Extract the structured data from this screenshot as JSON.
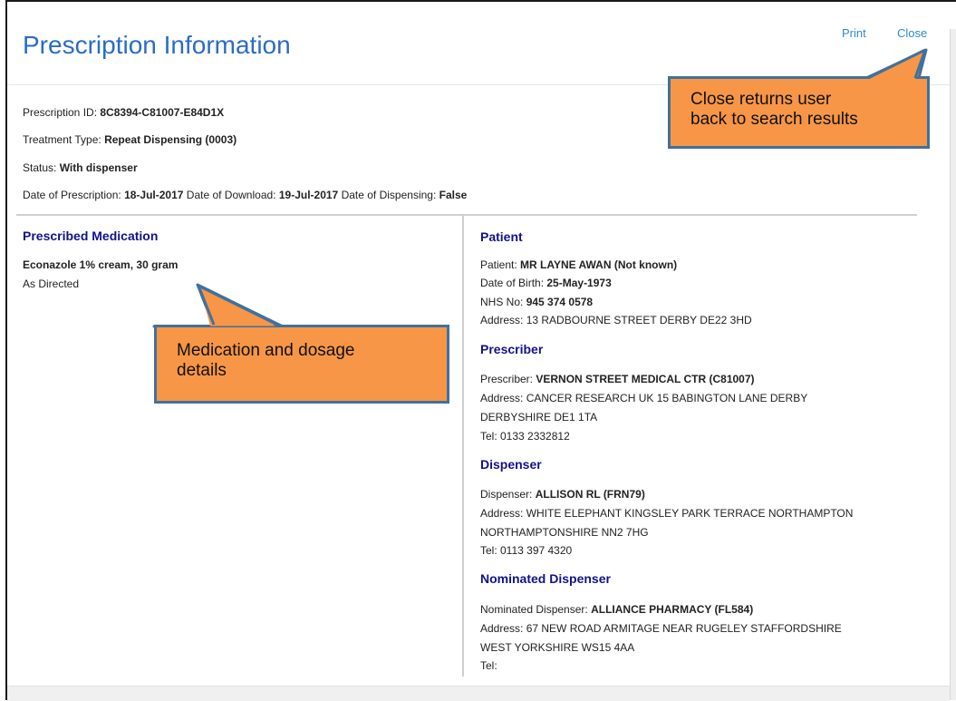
{
  "header": {
    "title": "Prescription Information",
    "print_label": "Print",
    "close_label": "Close"
  },
  "meta": {
    "prescription_id_label": "Prescription ID:",
    "prescription_id": "8C8394-C81007-E84D1X",
    "treatment_type_label": "Treatment Type:",
    "treatment_type": "Repeat Dispensing (0003)",
    "status_label": "Status:",
    "status": "With dispenser",
    "date_of_prescription_label": "Date of Prescription:",
    "date_of_prescription": "18-Jul-2017",
    "date_of_download_label": "Date of Download:",
    "date_of_download": "19-Jul-2017",
    "date_of_dispensing_label": "Date of Dispensing:",
    "date_of_dispensing": "False"
  },
  "medication": {
    "heading": "Prescribed Medication",
    "item": "Econazole 1% cream, 30 gram",
    "dosage": "As Directed"
  },
  "patient": {
    "heading": "Patient",
    "name_label": "Patient:",
    "name": "MR LAYNE AWAN (Not known)",
    "dob_label": "Date of Birth:",
    "dob": "25-May-1973",
    "nhs_label": "NHS No:",
    "nhs": "945 374 0578",
    "address": "Address: 13 RADBOURNE STREET DERBY DE22 3HD"
  },
  "prescriber": {
    "heading": "Prescriber",
    "name_label": "Prescriber:",
    "name": "VERNON STREET MEDICAL CTR (C81007)",
    "address_line1": "Address: CANCER RESEARCH UK 15 BABINGTON LANE DERBY",
    "address_line2": "DERBYSHIRE DE1 1TA",
    "tel": "Tel: 0133 2332812"
  },
  "dispenser": {
    "heading": "Dispenser",
    "name_label": "Dispenser:",
    "name": "ALLISON RL (FRN79)",
    "address_line1": "Address: WHITE ELEPHANT KINGSLEY PARK TERRACE NORTHAMPTON",
    "address_line2": "NORTHAMPTONSHIRE NN2 7HG",
    "tel": "Tel: 0113 397 4320"
  },
  "nominated_dispenser": {
    "heading": "Nominated Dispenser",
    "name_label": "Nominated Dispenser:",
    "name": "ALLIANCE PHARMACY (FL584)",
    "address_line1": "Address: 67 NEW ROAD ARMITAGE NEAR RUGELEY STAFFORDSHIRE",
    "address_line2": "WEST YORKSHIRE WS15 4AA",
    "tel": "Tel:"
  },
  "callouts": {
    "close_line1": "Close returns user",
    "close_line2": "back to search results",
    "medication_line1": "Medication and dosage",
    "medication_line2": "details"
  },
  "colors": {
    "title": "#2b6cc4",
    "link": "#2a8ad6",
    "section_heading": "#12128a",
    "callout_fill": "#f79646",
    "callout_border": "#41719c"
  }
}
